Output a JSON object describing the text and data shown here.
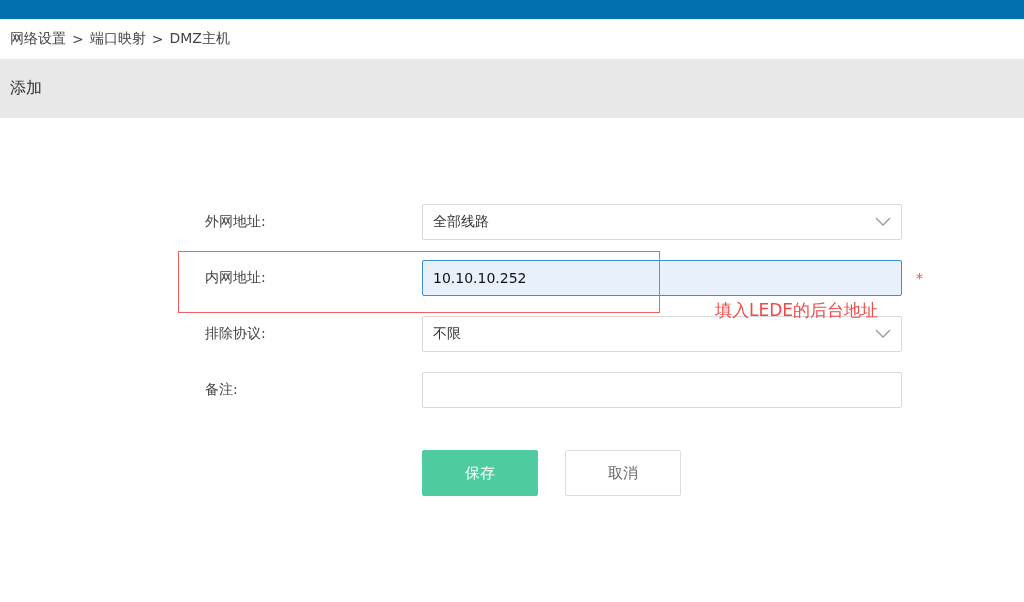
{
  "breadcrumb": [
    "网络设置",
    "端口映射",
    "DMZ主机"
  ],
  "breadcrumb_separator": ">",
  "panel_title": "添加",
  "fields": [
    {
      "label": "外网地址:",
      "kind": "select",
      "value": "全部线路",
      "focused": false,
      "required": false
    },
    {
      "label": "内网地址:",
      "kind": "input",
      "value": "10.10.10.252",
      "focused": true,
      "required": true
    },
    {
      "label": "排除协议:",
      "kind": "select",
      "value": "不限",
      "focused": false,
      "required": false
    },
    {
      "label": "备注:",
      "kind": "input",
      "focused": false,
      "required": false
    }
  ],
  "required_mark": "*",
  "buttons": [
    {
      "label": "保存",
      "kind": "primary"
    },
    {
      "label": "取消",
      "kind": "secondary"
    }
  ],
  "annotation": {
    "text": "填入LEDE的后台地址"
  }
}
